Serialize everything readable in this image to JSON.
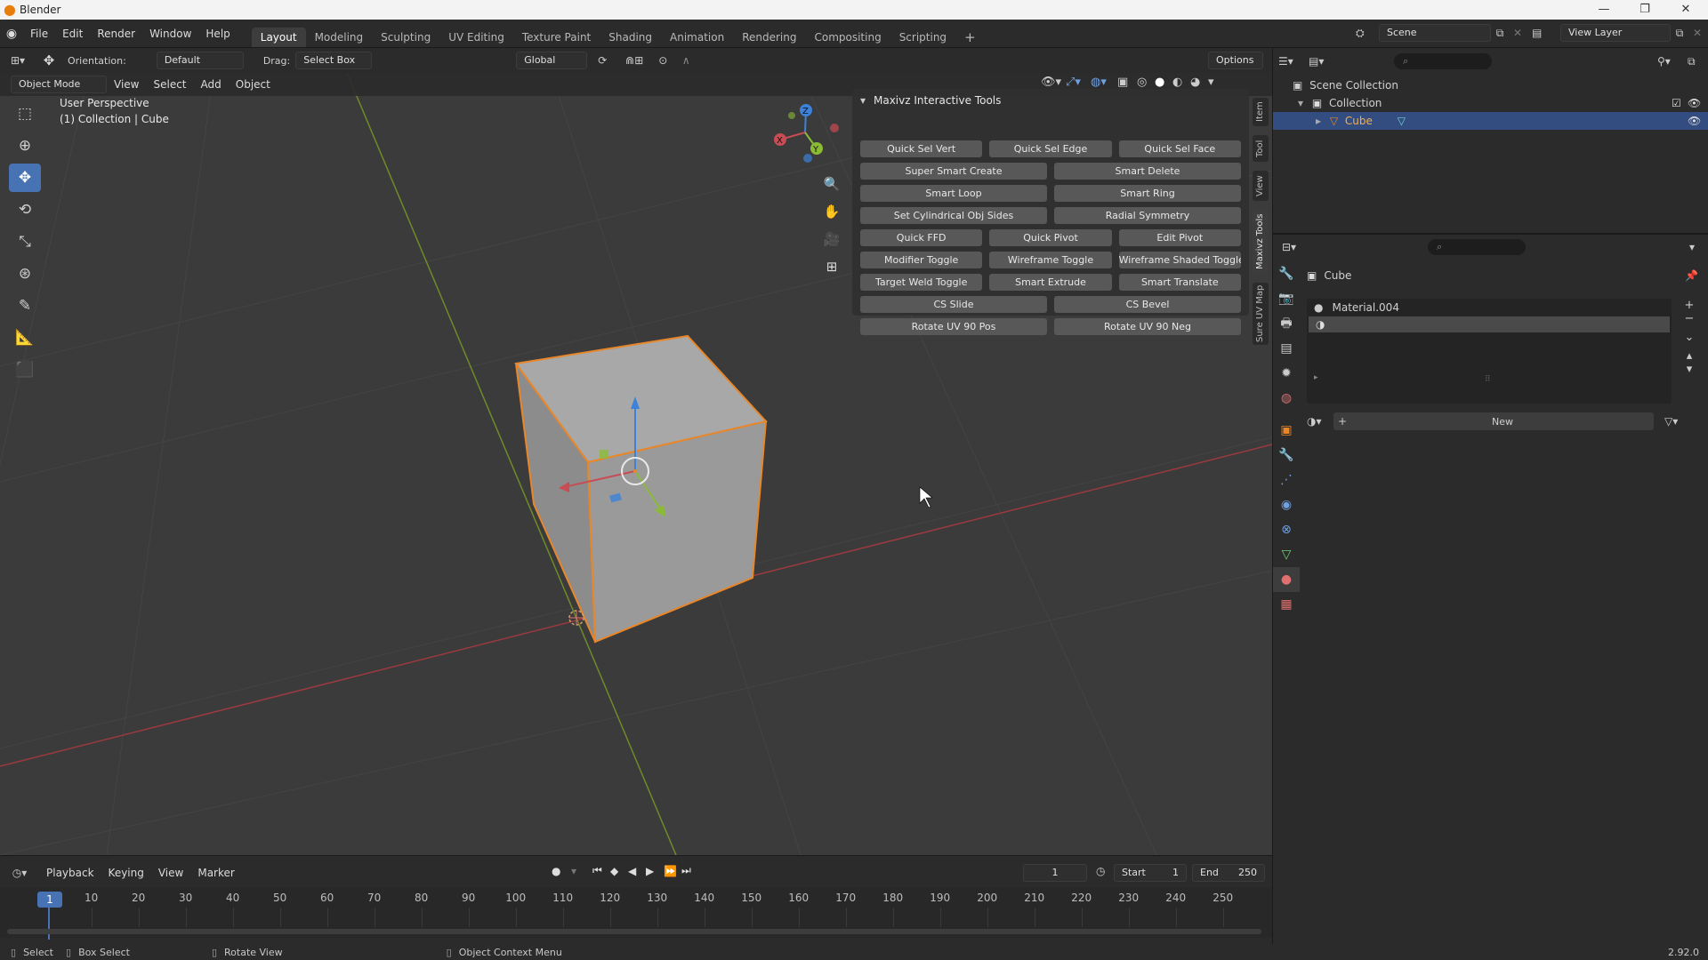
{
  "app": {
    "title": "Blender",
    "version": "2.92.0"
  },
  "menu": [
    "File",
    "Edit",
    "Render",
    "Window",
    "Help"
  ],
  "workspaces": [
    "Layout",
    "Modeling",
    "Sculpting",
    "UV Editing",
    "Texture Paint",
    "Shading",
    "Animation",
    "Rendering",
    "Compositing",
    "Scripting"
  ],
  "active_workspace": "Layout",
  "scene": {
    "name": "Scene",
    "view_layer": "View Layer"
  },
  "header": {
    "orientation_label": "Orientation:",
    "orientation_value": "Default",
    "drag_label": "Drag:",
    "drag_value": "Select Box",
    "transform_orientation": "Global",
    "options": "Options"
  },
  "viewport_header": {
    "mode": "Object Mode",
    "menus": [
      "View",
      "Select",
      "Add",
      "Object"
    ]
  },
  "viewport": {
    "perspective": "User Perspective",
    "collection_info": "(1) Collection | Cube"
  },
  "gizmo": {
    "x": "X",
    "y": "Y",
    "z": "Z"
  },
  "maxivz_panel": {
    "title": "Maxivz Interactive Tools",
    "buttons": [
      [
        "Quick Sel Vert",
        "Quick Sel Edge",
        "Quick Sel Face"
      ],
      [
        "Super Smart Create",
        "Smart Delete"
      ],
      [
        "Smart Loop",
        "Smart Ring"
      ],
      [
        "Set Cylindrical Obj Sides",
        "Radial Symmetry"
      ],
      [
        "Quick FFD",
        "Quick Pivot",
        "Edit Pivot"
      ],
      [
        "Modifier Toggle",
        "Wireframe Toggle",
        "Wireframe Shaded Toggle"
      ],
      [
        "Target Weld Toggle",
        "Smart Extrude",
        "Smart Translate"
      ],
      [
        "CS Slide",
        "CS Bevel"
      ],
      [
        "Rotate UV 90 Pos",
        "Rotate UV 90 Neg"
      ]
    ]
  },
  "sidebar_tabs": [
    "Item",
    "Tool",
    "View",
    "Maxivz Tools",
    "Sure UV Map"
  ],
  "timeline": {
    "menus": [
      "Playback",
      "Keying",
      "View",
      "Marker"
    ],
    "current_frame": "1",
    "start_label": "Start",
    "start_value": "1",
    "end_label": "End",
    "end_value": "250",
    "ticks": [
      "10",
      "20",
      "30",
      "40",
      "50",
      "60",
      "70",
      "80",
      "90",
      "100",
      "110",
      "120",
      "130",
      "140",
      "150",
      "160",
      "170",
      "180",
      "190",
      "200",
      "210",
      "220",
      "230",
      "240",
      "250"
    ],
    "playhead": "1"
  },
  "outliner": {
    "scene_collection": "Scene Collection",
    "collection": "Collection",
    "object": "Cube"
  },
  "properties": {
    "object_name": "Cube",
    "material_slot": "Material.004",
    "new_button": "New"
  },
  "statusbar": {
    "select": "Select",
    "box_select": "Box Select",
    "rotate_view": "Rotate View",
    "context_menu": "Object Context Menu",
    "version": "2.92.0"
  },
  "colors": {
    "accent": "#4772b3",
    "selected_outline": "#e8862a",
    "x_axis": "#c74c54",
    "y_axis": "#8bbb35",
    "z_axis": "#3c82d8"
  }
}
